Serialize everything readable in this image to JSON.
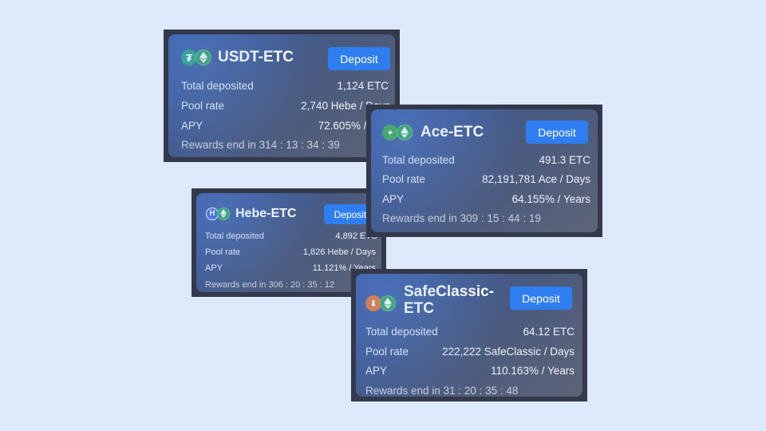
{
  "cards": [
    {
      "pair": "USDT-ETC",
      "token_icon": "tether-icon",
      "token_color": "#26a17b",
      "deposit_label": "Deposit",
      "total_deposited_label": "Total deposited",
      "total_deposited": "1,124 ETC",
      "pool_rate_label": "Pool rate",
      "pool_rate": "2,740 Hebe / Days",
      "apy_label": "APY",
      "apy": "72.605% / Years",
      "rewards_label": "Rewards end in",
      "rewards_end": "314 : 13 : 34 : 39"
    },
    {
      "pair": "Ace-ETC",
      "token_icon": "ace-icon",
      "token_color": "#3aa84a",
      "deposit_label": "Deposit",
      "total_deposited_label": "Total deposited",
      "total_deposited": "491.3 ETC",
      "pool_rate_label": "Pool rate",
      "pool_rate": "82,191,781 Ace / Days",
      "apy_label": "APY",
      "apy": "64.155% / Years",
      "rewards_label": "Rewards end in",
      "rewards_end": "309 : 15 : 44 : 19"
    },
    {
      "pair": "Hebe-ETC",
      "token_icon": "hebe-icon",
      "token_color": "#3b63d6",
      "deposit_label": "Deposit",
      "total_deposited_label": "Total deposited",
      "total_deposited": "4,892 ETC",
      "pool_rate_label": "Pool rate",
      "pool_rate": "1,826 Hebe / Days",
      "apy_label": "APY",
      "apy": "11.121% / Years",
      "rewards_label": "Rewards end in",
      "rewards_end": "306 : 20 : 35 : 12"
    },
    {
      "pair": "SafeClassic-ETC",
      "token_icon": "safeclassic-icon",
      "token_color": "#e8742a",
      "deposit_label": "Deposit",
      "total_deposited_label": "Total deposited",
      "total_deposited": "64.12 ETC",
      "pool_rate_label": "Pool rate",
      "pool_rate": "222,222 SafeClassic / Days",
      "apy_label": "APY",
      "apy": "110.163% / Years",
      "rewards_label": "Rewards end in",
      "rewards_end": "31 : 20 : 35 : 48"
    }
  ],
  "etc_icon": "ethereum-classic-icon",
  "colors": {
    "background": "#dde9fb",
    "button": "#2f7ef0",
    "etc": "#2ea44f"
  }
}
